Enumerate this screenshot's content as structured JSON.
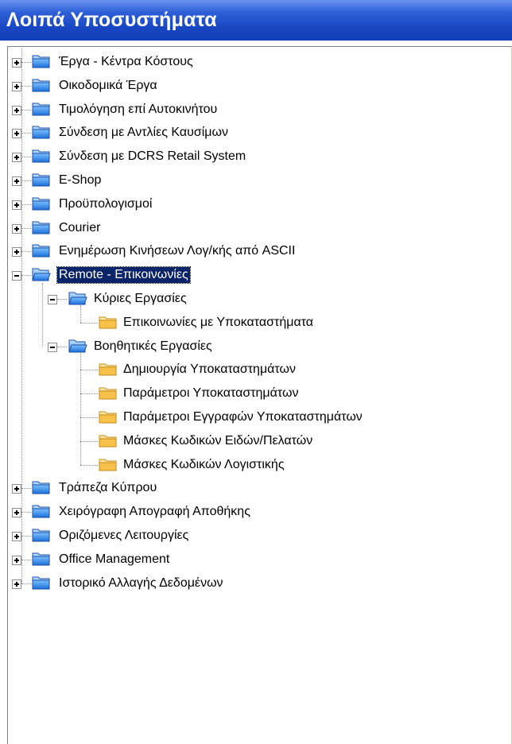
{
  "window": {
    "title": "Λοιπά Υποσυστήματα"
  },
  "tree": {
    "top_items": [
      {
        "label": "Έργα - Κέντρα Κόστους",
        "expanded": false
      },
      {
        "label": "Οικοδομικά Έργα",
        "expanded": false
      },
      {
        "label": "Τιμολόγηση επί Αυτοκινήτου",
        "expanded": false
      },
      {
        "label": "Σύνδεση με Αντλίες Καυσίμων",
        "expanded": false
      },
      {
        "label": "Σύνδεση με DCRS Retail System",
        "expanded": false
      },
      {
        "label": "E-Shop",
        "expanded": false
      },
      {
        "label": "Προϋπολογισμοί",
        "expanded": false
      },
      {
        "label": "Courier",
        "expanded": false
      },
      {
        "label": "Ενημέρωση Κινήσεων Λογ/κής από ASCII",
        "expanded": false
      },
      {
        "label": "Remote - Επικοινωνίες",
        "expanded": true,
        "selected": true
      },
      {
        "label": "Τράπεζα Κύπρου",
        "expanded": false
      },
      {
        "label": "Χειρόγραφη Απογραφή Αποθήκης",
        "expanded": false
      },
      {
        "label": "Οριζόμενες Λειτουργίες",
        "expanded": false
      },
      {
        "label": "Office Management",
        "expanded": false
      },
      {
        "label": "Ιστορικό Αλλαγής Δεδομένων",
        "expanded": false
      }
    ],
    "remote_children": [
      {
        "label": "Κύριες Εργασίες",
        "children": [
          "Επικοινωνίες με Υποκαταστήματα"
        ]
      },
      {
        "label": "Βοηθητικές Εργασίες",
        "children": [
          "Δημιουργία Υποκαταστημάτων",
          "Παράμετροι Υποκαταστημάτων",
          "Παράμετροι Εγγραφών Υποκαταστημάτων",
          "Μάσκες Κωδικών Ειδών/Πελατών",
          "Μάσκες Κωδικών Λογιστικής"
        ]
      }
    ]
  },
  "colors": {
    "title_bar": "#1846c2",
    "folder_blue": "#3f8ee6",
    "folder_yellow": "#f7c24a",
    "selection": "#0a246a"
  }
}
